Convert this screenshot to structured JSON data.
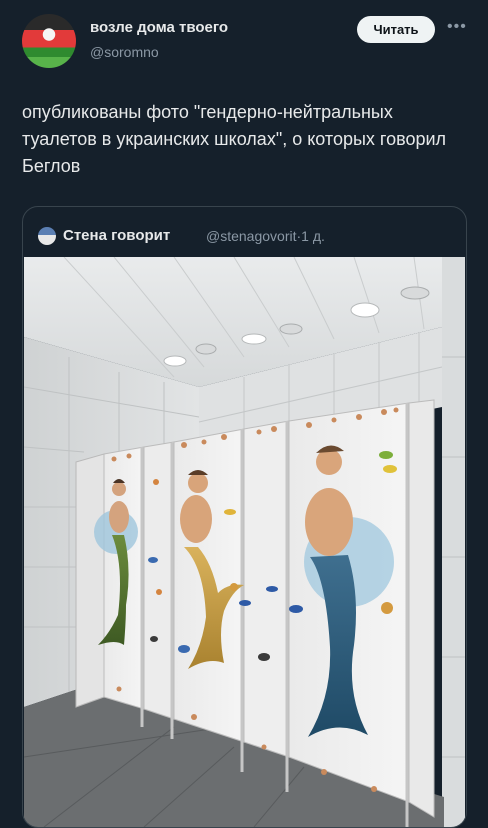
{
  "author": {
    "name": "возле дома твоего",
    "handle": "@soromno",
    "follow_label": "Читать"
  },
  "post": {
    "text": "опубликованы фото \"гендерно-нейтральных туалетов в украинских школах\", о которых говорил Беглов"
  },
  "quoted": {
    "name": "Стена говорит",
    "handle": "@stenagovorit",
    "separator": "·",
    "time": "1 д."
  },
  "colors": {
    "background": "#15202b",
    "text": "#e7e9ea",
    "secondary": "#8b98a5",
    "border": "#38444d"
  },
  "icons": {
    "more": "more-dots-icon",
    "avatar": "watermelon-avatar"
  }
}
